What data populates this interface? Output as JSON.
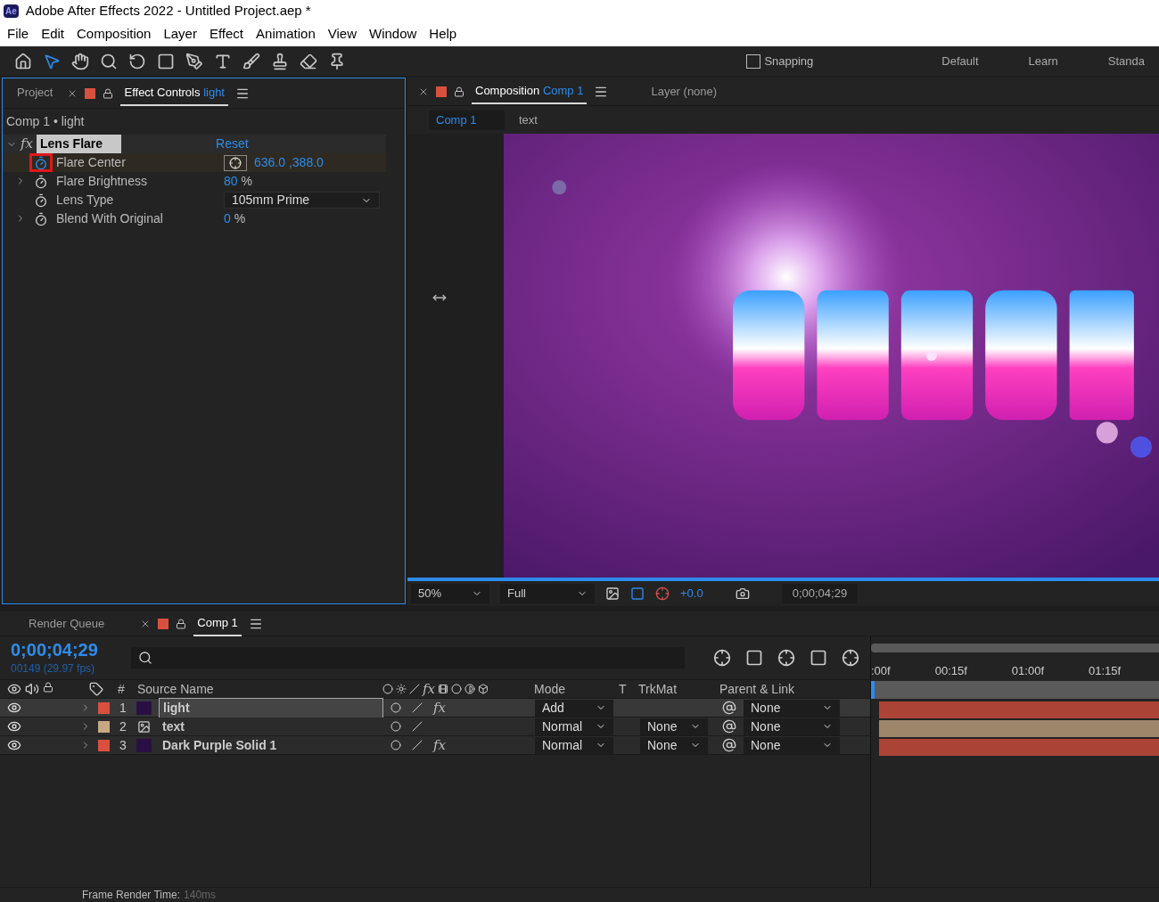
{
  "window": {
    "title": "Adobe After Effects 2022 - Untitled Project.aep *",
    "app_icon": "Ae"
  },
  "menu": [
    "File",
    "Edit",
    "Composition",
    "Layer",
    "Effect",
    "Animation",
    "View",
    "Window",
    "Help"
  ],
  "toolbar": {
    "snapping": {
      "label": "Snapping",
      "checked": false
    },
    "workspaces": [
      "Default",
      "Learn",
      "Standa"
    ]
  },
  "left_panel": {
    "tabs": [
      {
        "label": "Project",
        "selected": false
      },
      {
        "label": "Effect Controls",
        "suffix": "light",
        "selected": true
      }
    ],
    "breadcrumb": "Comp 1 • light",
    "effect": {
      "fx_label": "fx",
      "name": "Lens Flare",
      "expanded": true,
      "reset": "Reset",
      "properties": [
        {
          "kind": "point",
          "name": "Flare Center",
          "value": "636.0 ,388.0",
          "expandable": false,
          "highlighted": true
        },
        {
          "kind": "number",
          "name": "Flare Brightness",
          "value": "80",
          "unit": "%",
          "expandable": true,
          "highlighted": false
        },
        {
          "kind": "dropdown",
          "name": "Lens Type",
          "value": "105mm Prime",
          "expandable": false,
          "highlighted": false
        },
        {
          "kind": "number",
          "name": "Blend With Original",
          "value": "0",
          "unit": "%",
          "expandable": true,
          "highlighted": false
        }
      ]
    }
  },
  "comp_panel": {
    "tabs": [
      {
        "label": "Composition",
        "suffix": "Comp 1",
        "selected": true
      },
      {
        "label": "Layer (none)",
        "selected": false
      }
    ],
    "breadcrumbs": [
      {
        "label": "Comp 1",
        "selected": true
      },
      {
        "label": "text",
        "selected": false
      }
    ],
    "controls": {
      "zoom": "50%",
      "resolution": "Full",
      "exposure": "+0.0",
      "timecode": "0;00;04;29"
    }
  },
  "timeline": {
    "tabs": [
      {
        "label": "Render Queue",
        "selected": false
      },
      {
        "label": "Comp 1",
        "selected": true
      }
    ],
    "timecode": "0;00;04;29",
    "frame": "00149 (29.97 fps)",
    "fx_label": "fx",
    "columns": {
      "number": "#",
      "source": "Source Name",
      "mode": "Mode",
      "t": "T",
      "trkmat": "TrkMat",
      "parent": "Parent & Link"
    },
    "layers": [
      {
        "number": "1",
        "name": "light",
        "kind": "solid",
        "color": "#d9503f",
        "mode": "Add",
        "parent": "None",
        "fx": "fx",
        "selected": true
      },
      {
        "number": "2",
        "name": "text",
        "kind": "text",
        "color": "#c8a884",
        "mode": "Normal",
        "trkmat": "None",
        "parent": "None",
        "selected": false
      },
      {
        "number": "3",
        "name": "Dark Purple Solid 1",
        "kind": "solid",
        "color": "#d9503f",
        "mode": "Normal",
        "trkmat": "None",
        "parent": "None",
        "fx": "fx",
        "selected": false
      }
    ],
    "ruler": [
      ":00f",
      "00:15f",
      "01:00f",
      "01:15f"
    ]
  },
  "status_bar": {
    "label": "Frame Render Time:",
    "value": "140ms"
  }
}
